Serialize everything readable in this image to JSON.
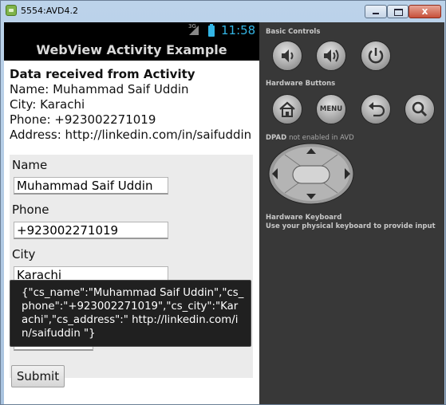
{
  "window": {
    "title": "5554:AVD4.2",
    "close_glyph": "x"
  },
  "statusbar": {
    "network": "3G",
    "time": "11:58"
  },
  "actionbar": {
    "title": "WebView Activity Example"
  },
  "received": {
    "heading": "Data received from Activity",
    "lines": [
      "Name: Muhammad Saif Uddin",
      "City: Karachi",
      "Phone: +923002271019",
      "Address: http://linkedin.com/in/saifuddin"
    ]
  },
  "form": {
    "name_label": "Name",
    "name_value": "Muhammad Saif Uddin",
    "phone_label": "Phone",
    "phone_value": "+923002271019",
    "city_label": "City",
    "city_value": "Karachi",
    "submit_label": "Submit"
  },
  "toast": {
    "text": "{\"cs_name\":\"Muhammad Saif Uddin\",\"cs_phone\":\"+923002271019\",\"cs_city\":\"Karachi\",\"cs_address\":\" http://linkedin.com/in/saifuddin \"}"
  },
  "controls": {
    "basic_title": "Basic Controls",
    "hardware_title": "Hardware Buttons",
    "menu_label": "MENU",
    "dpad_title": "DPAD",
    "dpad_note": "not enabled in AVD",
    "keyboard_title": "Hardware Keyboard",
    "keyboard_note": "Use your physical keyboard to provide input",
    "icons": [
      "volume-down-icon",
      "volume-up-icon",
      "power-icon",
      "home-icon",
      "menu-icon",
      "back-icon",
      "search-icon"
    ]
  }
}
